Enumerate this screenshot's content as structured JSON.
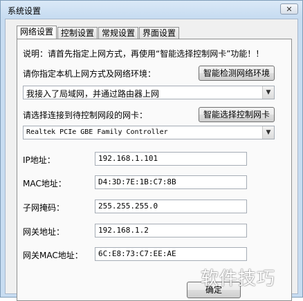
{
  "window": {
    "title": "系统设置"
  },
  "tabs": [
    {
      "label": "网络设置",
      "active": true
    },
    {
      "label": "控制设置",
      "active": false
    },
    {
      "label": "常规设置",
      "active": false
    },
    {
      "label": "界面设置",
      "active": false
    }
  ],
  "network": {
    "note": "说明：请首先指定上网方式，再使用“智能选择控制网卡”功能！！",
    "env_label": "请你指定本机上网方式及网络环境：",
    "detect_button": "智能检测网络环境",
    "env_selected": "我接入了局域网，并通过路由器上网",
    "nic_label": "请选择连接到待控制网段的网卡：",
    "nic_button": "智能选择控制网卡",
    "nic_selected": "Realtek PCIe GBE Family Controller",
    "fields": [
      {
        "label": "IP地址：",
        "value": "192.168.1.101"
      },
      {
        "label": "MAC地址：",
        "value": "D4:3D:7E:1B:C7:8B"
      },
      {
        "label": "子网掩码：",
        "value": "255.255.255.0"
      },
      {
        "label": "网关地址：",
        "value": "192.168.1.2"
      },
      {
        "label": "网关MAC地址：",
        "value": "6C:E8:73:C7:EE:AE"
      }
    ]
  },
  "footer": {
    "ok_label": "确定"
  },
  "watermark": "软件技巧"
}
